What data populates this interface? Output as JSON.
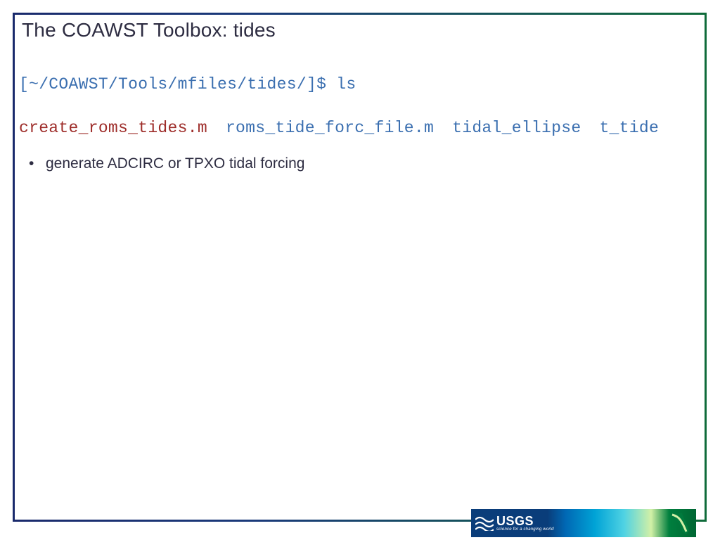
{
  "slide": {
    "title": "The COAWST Toolbox: tides",
    "prompt": "[~/COAWST/Tools/mfiles/tides/]$ ls",
    "ls": {
      "file1": "create_roms_tides.m",
      "file2": "roms_tide_forc_file.m",
      "file3": "tidal_ellipse",
      "file4": "t_tide"
    },
    "bullets": [
      "generate ADCIRC or TPXO tidal forcing"
    ]
  },
  "footer": {
    "org": "USGS",
    "tagline": "science for a changing world"
  }
}
